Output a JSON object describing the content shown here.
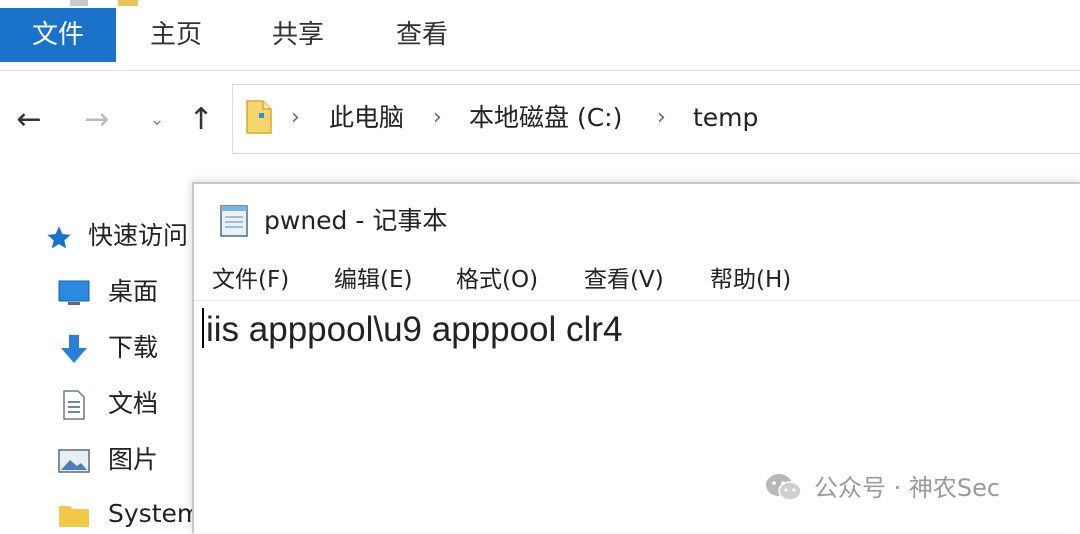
{
  "ribbon": {
    "tabs": [
      {
        "label": "文件",
        "active": true
      },
      {
        "label": "主页",
        "active": false
      },
      {
        "label": "共享",
        "active": false
      },
      {
        "label": "查看",
        "active": false
      }
    ]
  },
  "nav": {
    "back": "←",
    "forward": "→",
    "recent": "⌄",
    "up": "↑"
  },
  "address": {
    "crumbs": [
      "此电脑",
      "本地磁盘 (C:)",
      "temp"
    ],
    "separator": "›"
  },
  "sidebar": {
    "items": [
      {
        "label": "快速访问",
        "icon": "star-icon"
      },
      {
        "label": "桌面",
        "icon": "desktop-icon"
      },
      {
        "label": "下载",
        "icon": "download-icon"
      },
      {
        "label": "文档",
        "icon": "document-icon"
      },
      {
        "label": "图片",
        "icon": "pictures-icon"
      },
      {
        "label": "System",
        "icon": "folder-icon"
      }
    ]
  },
  "notepad": {
    "title": "pwned - 记事本",
    "menus": [
      "文件(F)",
      "编辑(E)",
      "格式(O)",
      "查看(V)",
      "帮助(H)"
    ],
    "content": "iis apppool\\u9 apppool clr4"
  },
  "watermark": {
    "text": "公众号 · 神农Sec"
  },
  "colors": {
    "accent": "#1a73c8",
    "folder": "#f3c94a",
    "star": "#1a73c8"
  }
}
